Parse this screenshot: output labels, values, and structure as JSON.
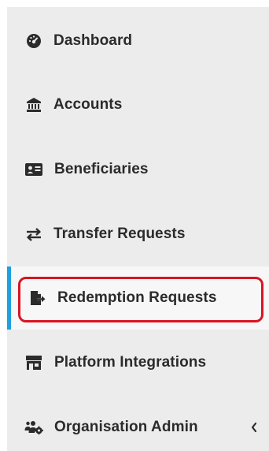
{
  "sidebar": {
    "items": [
      {
        "label": "Dashboard",
        "icon": "dashboard-gauge-icon",
        "active": false
      },
      {
        "label": "Accounts",
        "icon": "bank-icon",
        "active": false
      },
      {
        "label": "Beneficiaries",
        "icon": "id-card-icon",
        "active": false
      },
      {
        "label": "Transfer Requests",
        "icon": "exchange-arrows-icon",
        "active": false
      },
      {
        "label": "Redemption Requests",
        "icon": "file-export-icon",
        "active": true
      },
      {
        "label": "Platform Integrations",
        "icon": "store-icon",
        "active": false
      },
      {
        "label": "Organisation Admin",
        "icon": "users-cog-icon",
        "active": false,
        "has_submenu": true,
        "chevron": "chevron-left-icon"
      }
    ]
  },
  "colors": {
    "sidebar_bg": "#ececec",
    "active_bg": "#f7f7f7",
    "active_bar": "#1ea1de",
    "highlight_border": "#d91423",
    "text": "#2b2b2b"
  }
}
